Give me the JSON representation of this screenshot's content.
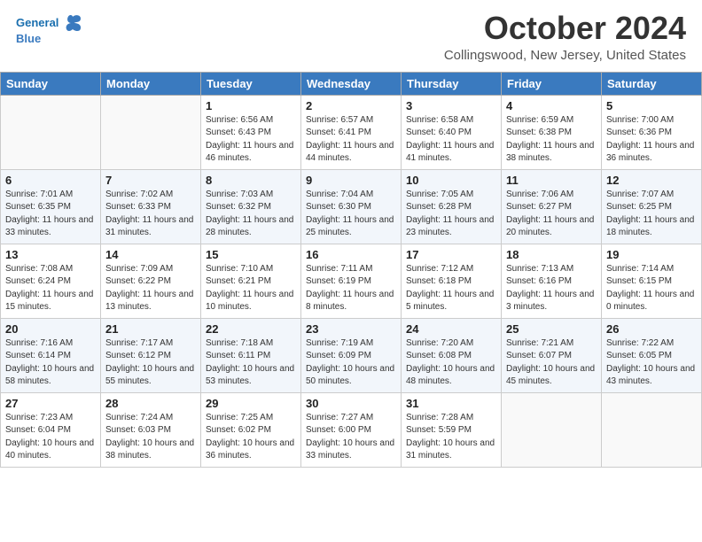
{
  "header": {
    "logo_line1": "General",
    "logo_line2": "Blue",
    "month": "October 2024",
    "location": "Collingswood, New Jersey, United States"
  },
  "weekdays": [
    "Sunday",
    "Monday",
    "Tuesday",
    "Wednesday",
    "Thursday",
    "Friday",
    "Saturday"
  ],
  "weeks": [
    [
      {
        "day": "",
        "info": ""
      },
      {
        "day": "",
        "info": ""
      },
      {
        "day": "1",
        "info": "Sunrise: 6:56 AM\nSunset: 6:43 PM\nDaylight: 11 hours and 46 minutes."
      },
      {
        "day": "2",
        "info": "Sunrise: 6:57 AM\nSunset: 6:41 PM\nDaylight: 11 hours and 44 minutes."
      },
      {
        "day": "3",
        "info": "Sunrise: 6:58 AM\nSunset: 6:40 PM\nDaylight: 11 hours and 41 minutes."
      },
      {
        "day": "4",
        "info": "Sunrise: 6:59 AM\nSunset: 6:38 PM\nDaylight: 11 hours and 38 minutes."
      },
      {
        "day": "5",
        "info": "Sunrise: 7:00 AM\nSunset: 6:36 PM\nDaylight: 11 hours and 36 minutes."
      }
    ],
    [
      {
        "day": "6",
        "info": "Sunrise: 7:01 AM\nSunset: 6:35 PM\nDaylight: 11 hours and 33 minutes."
      },
      {
        "day": "7",
        "info": "Sunrise: 7:02 AM\nSunset: 6:33 PM\nDaylight: 11 hours and 31 minutes."
      },
      {
        "day": "8",
        "info": "Sunrise: 7:03 AM\nSunset: 6:32 PM\nDaylight: 11 hours and 28 minutes."
      },
      {
        "day": "9",
        "info": "Sunrise: 7:04 AM\nSunset: 6:30 PM\nDaylight: 11 hours and 25 minutes."
      },
      {
        "day": "10",
        "info": "Sunrise: 7:05 AM\nSunset: 6:28 PM\nDaylight: 11 hours and 23 minutes."
      },
      {
        "day": "11",
        "info": "Sunrise: 7:06 AM\nSunset: 6:27 PM\nDaylight: 11 hours and 20 minutes."
      },
      {
        "day": "12",
        "info": "Sunrise: 7:07 AM\nSunset: 6:25 PM\nDaylight: 11 hours and 18 minutes."
      }
    ],
    [
      {
        "day": "13",
        "info": "Sunrise: 7:08 AM\nSunset: 6:24 PM\nDaylight: 11 hours and 15 minutes."
      },
      {
        "day": "14",
        "info": "Sunrise: 7:09 AM\nSunset: 6:22 PM\nDaylight: 11 hours and 13 minutes."
      },
      {
        "day": "15",
        "info": "Sunrise: 7:10 AM\nSunset: 6:21 PM\nDaylight: 11 hours and 10 minutes."
      },
      {
        "day": "16",
        "info": "Sunrise: 7:11 AM\nSunset: 6:19 PM\nDaylight: 11 hours and 8 minutes."
      },
      {
        "day": "17",
        "info": "Sunrise: 7:12 AM\nSunset: 6:18 PM\nDaylight: 11 hours and 5 minutes."
      },
      {
        "day": "18",
        "info": "Sunrise: 7:13 AM\nSunset: 6:16 PM\nDaylight: 11 hours and 3 minutes."
      },
      {
        "day": "19",
        "info": "Sunrise: 7:14 AM\nSunset: 6:15 PM\nDaylight: 11 hours and 0 minutes."
      }
    ],
    [
      {
        "day": "20",
        "info": "Sunrise: 7:16 AM\nSunset: 6:14 PM\nDaylight: 10 hours and 58 minutes."
      },
      {
        "day": "21",
        "info": "Sunrise: 7:17 AM\nSunset: 6:12 PM\nDaylight: 10 hours and 55 minutes."
      },
      {
        "day": "22",
        "info": "Sunrise: 7:18 AM\nSunset: 6:11 PM\nDaylight: 10 hours and 53 minutes."
      },
      {
        "day": "23",
        "info": "Sunrise: 7:19 AM\nSunset: 6:09 PM\nDaylight: 10 hours and 50 minutes."
      },
      {
        "day": "24",
        "info": "Sunrise: 7:20 AM\nSunset: 6:08 PM\nDaylight: 10 hours and 48 minutes."
      },
      {
        "day": "25",
        "info": "Sunrise: 7:21 AM\nSunset: 6:07 PM\nDaylight: 10 hours and 45 minutes."
      },
      {
        "day": "26",
        "info": "Sunrise: 7:22 AM\nSunset: 6:05 PM\nDaylight: 10 hours and 43 minutes."
      }
    ],
    [
      {
        "day": "27",
        "info": "Sunrise: 7:23 AM\nSunset: 6:04 PM\nDaylight: 10 hours and 40 minutes."
      },
      {
        "day": "28",
        "info": "Sunrise: 7:24 AM\nSunset: 6:03 PM\nDaylight: 10 hours and 38 minutes."
      },
      {
        "day": "29",
        "info": "Sunrise: 7:25 AM\nSunset: 6:02 PM\nDaylight: 10 hours and 36 minutes."
      },
      {
        "day": "30",
        "info": "Sunrise: 7:27 AM\nSunset: 6:00 PM\nDaylight: 10 hours and 33 minutes."
      },
      {
        "day": "31",
        "info": "Sunrise: 7:28 AM\nSunset: 5:59 PM\nDaylight: 10 hours and 31 minutes."
      },
      {
        "day": "",
        "info": ""
      },
      {
        "day": "",
        "info": ""
      }
    ]
  ]
}
